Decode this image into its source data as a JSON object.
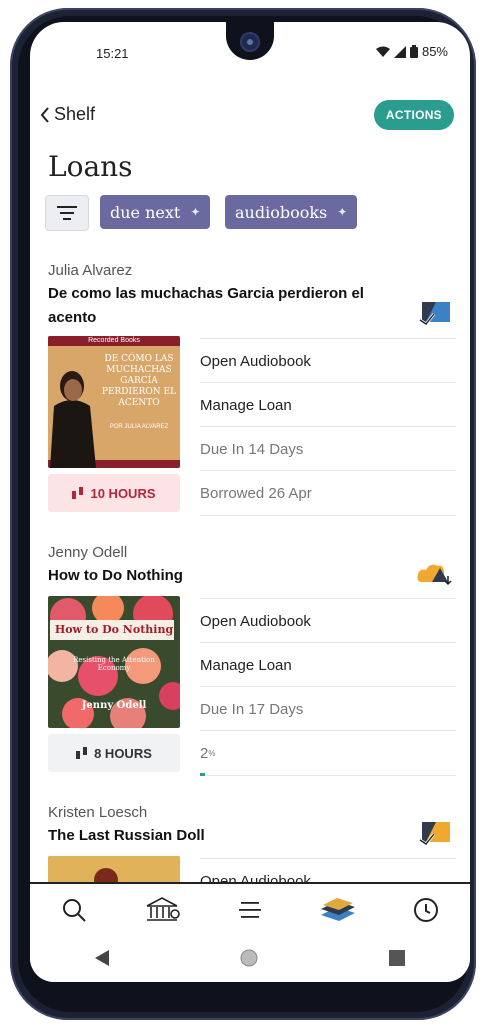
{
  "status_bar": {
    "time": "15:21",
    "battery": "85%"
  },
  "header": {
    "back_label": "Shelf",
    "actions_label": "ACTIONS"
  },
  "page_title": "Loans",
  "chips": [
    {
      "label": "due next"
    },
    {
      "label": "audiobooks"
    }
  ],
  "loans": [
    {
      "author": "Julia Alvarez",
      "title": "De como las muchachas Garcia perdieron el acento",
      "cover": {
        "publisher": "Recorded Books",
        "title": "DE CÓMO LAS MUCHACHAS GARCÍA PERDIERON EL ACENTO",
        "author": "POR JULIA ALVAREZ"
      },
      "open_label": "Open Audiobook",
      "manage_label": "Manage Loan",
      "due_label": "Due In 14 Days",
      "extra_label": "Borrowed 26 Apr",
      "hours_label": "10 HOURS",
      "hours_color": "#b3263a"
    },
    {
      "author": "Jenny Odell",
      "title": "How to Do Nothing",
      "cover": {
        "title": "How to Do Nothing",
        "subtitle": "Resisting the Attention Economy",
        "author": "Jenny Odell"
      },
      "open_label": "Open Audiobook",
      "manage_label": "Manage Loan",
      "due_label": "Due In 17 Days",
      "progress_label": "2",
      "progress_unit": "%",
      "progress": 0.02,
      "hours_label": "8 HOURS",
      "hours_color": "#333333"
    },
    {
      "author": "Kristen Loesch",
      "title": "The Last Russian Doll",
      "open_label": "Open Audiobook"
    }
  ],
  "nav": [
    {
      "icon": "search-icon"
    },
    {
      "icon": "library-icon"
    },
    {
      "icon": "menu-icon"
    },
    {
      "icon": "books-stack-icon"
    },
    {
      "icon": "clock-icon"
    }
  ],
  "colors": {
    "accent": "#2a9d8f",
    "chip": "#6a6aa1",
    "hours_red": "#b3263a"
  }
}
